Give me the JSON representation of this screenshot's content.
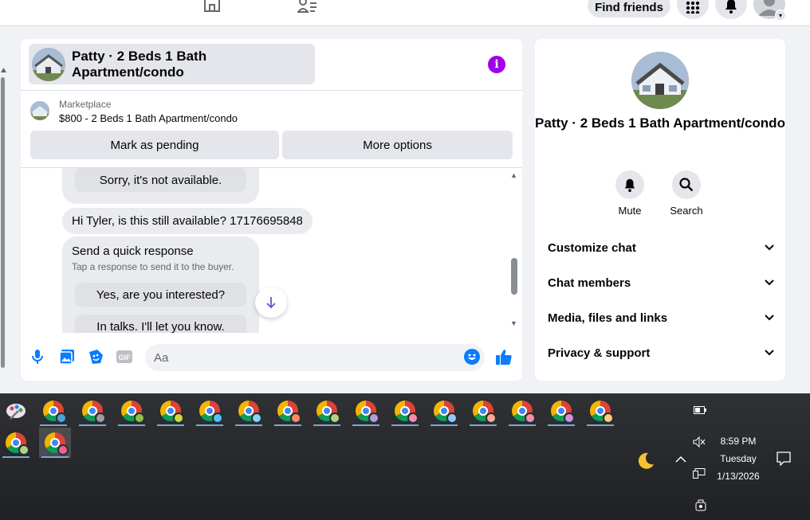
{
  "topbar": {
    "find_friends": "Find friends"
  },
  "chat": {
    "title": "Patty · 2 Beds 1 Bath Apartment/condo",
    "marketplace_label": "Marketplace",
    "listing": "$800 - 2 Beds 1 Bath Apartment/condo",
    "mark_pending": "Mark as pending",
    "more_options": "More options",
    "messages": {
      "sorry": "Sorry, it's not available.",
      "buyer_msg": "Hi Tyler, is this still available? 17176695848",
      "quick_title": "Send a quick response",
      "quick_sub": "Tap a response to send it to the buyer.",
      "quick_1": "Yes, are you interested?",
      "quick_2": "In talks. I'll let you know."
    },
    "input_placeholder": "Aa"
  },
  "details": {
    "title": "Patty · 2 Beds 1 Bath Apartment/condo",
    "mute": "Mute",
    "search": "Search",
    "sections": [
      "Customize chat",
      "Chat members",
      "Media, files and links",
      "Privacy & support"
    ]
  },
  "taskbar": {
    "time": "8:59 PM",
    "day": "Tuesday",
    "date": "1/13/2026",
    "badge_colors": [
      "#4aa3df",
      "#9e9e9e",
      "#8bc34a",
      "#cddc39",
      "#4fc3f7",
      "#81d4fa",
      "#ff8a65",
      "#aed581",
      "#b39ddb",
      "#f48fb1",
      "#90caf9",
      "#ffab91",
      "#f48fb1",
      "#ce93d8",
      "#ffcc80",
      "#aed581",
      "#f06292"
    ]
  },
  "colors": {
    "messenger_accent": "#0a7cff",
    "info_purple": "#a100e8"
  }
}
